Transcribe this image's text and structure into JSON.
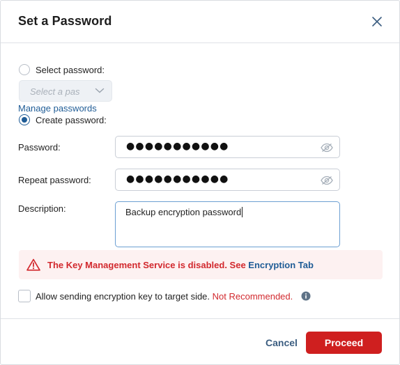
{
  "dialog": {
    "title": "Set a Password"
  },
  "options": {
    "select_password_label": "Select password:",
    "select_placeholder": "Select a pas",
    "manage_link": "Manage passwords",
    "create_password_label": "Create password:",
    "selected_option": "create"
  },
  "form": {
    "password_label": "Password:",
    "password_value": "●●●●●●●●●●●",
    "repeat_label": "Repeat password:",
    "repeat_value": "●●●●●●●●●●●",
    "description_label": "Description:",
    "description_value": "Backup encryption password"
  },
  "alert": {
    "message": "The Key Management Service is disabled. See ",
    "link": "Encryption Tab"
  },
  "send_key": {
    "label": "Allow sending encryption key to target side. ",
    "warning": "Not Recommended.",
    "checked": false
  },
  "footer": {
    "cancel_label": "Cancel",
    "proceed_label": "Proceed"
  },
  "colors": {
    "accent": "#1f5c96",
    "danger": "#cf1f1f",
    "alert_bg": "#fdf1f1"
  },
  "icons": {
    "close": "close-icon",
    "chevron": "chevron-down-icon",
    "eye": "eye-icon",
    "warning": "warning-triangle-icon",
    "info": "info-icon"
  }
}
